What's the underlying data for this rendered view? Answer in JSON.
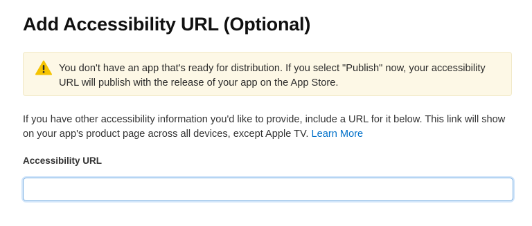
{
  "page": {
    "title": "Add Accessibility URL (Optional)"
  },
  "warning": {
    "icon": "warning-triangle-icon",
    "text": "You don't have an app that's ready for distribution. If you select \"Publish\" now, your accessibility URL will publish with the release of your app on the App Store.",
    "colors": {
      "background": "#fdf8e6",
      "border": "#f1e9c7",
      "icon": "#f5c300"
    }
  },
  "description": {
    "text": "If you have other accessibility information you'd like to provide, include a URL for it below. This link will show on your app's product page across all devices, except Apple TV.",
    "link_label": "Learn More",
    "link_color": "#0070c9"
  },
  "field": {
    "label": "Accessibility URL",
    "value": "",
    "placeholder": ""
  }
}
